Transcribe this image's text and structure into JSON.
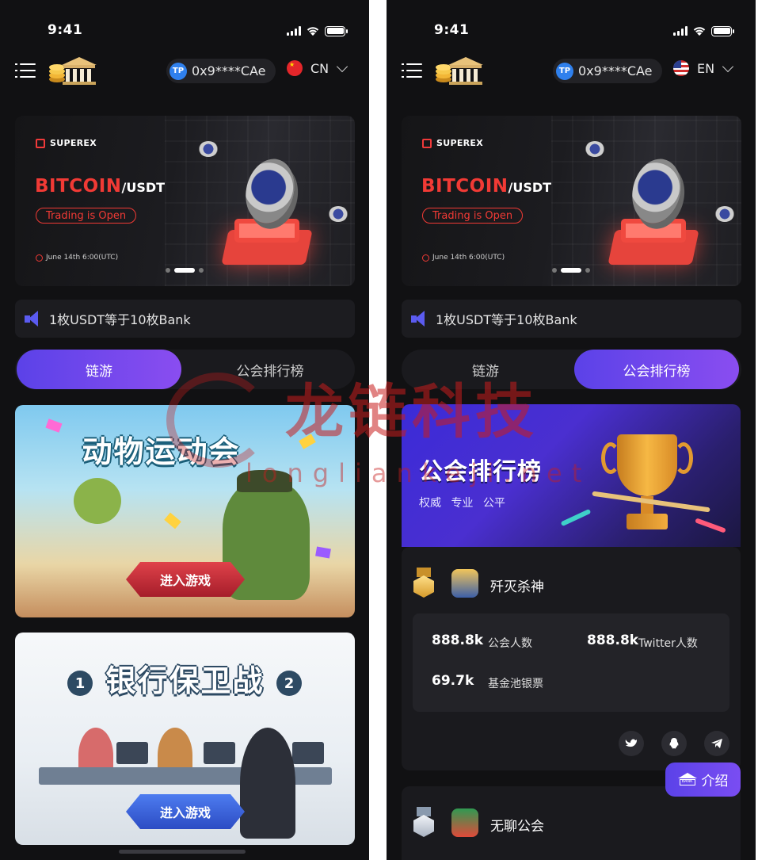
{
  "colors": {
    "background": "#111113",
    "accent_gradient_start": "#5b42e8",
    "accent_gradient_end": "#8a4df0",
    "brand_red": "#f13a35",
    "card": "#1a1a1e"
  },
  "screens": [
    {
      "status": {
        "time": "9:41"
      },
      "header": {
        "address": "0x9****CAe",
        "tp_label": "TP",
        "language": "CN",
        "flag": "china-flag"
      },
      "banner": {
        "brand": "SUPEREX",
        "pair_main": "BITCOIN",
        "pair_quote": "/USDT",
        "badge": "Trading is Open",
        "date": "June 14th  6:00(UTC)"
      },
      "notice": {
        "text": "1枚USDT等于10枚Bank"
      },
      "tabs": [
        {
          "label": "链游",
          "active": true
        },
        {
          "label": "公会排行榜",
          "active": false
        }
      ],
      "games": [
        {
          "title": "动物运动会",
          "button": "进入游戏"
        },
        {
          "title": "银行保卫战",
          "button": "进入游戏",
          "badges": [
            "1",
            "2"
          ]
        }
      ]
    },
    {
      "status": {
        "time": "9:41"
      },
      "header": {
        "address": "0x9****CAe",
        "tp_label": "TP",
        "language": "EN",
        "flag": "us-flag"
      },
      "banner": {
        "brand": "SUPEREX",
        "pair_main": "BITCOIN",
        "pair_quote": "/USDT",
        "badge": "Trading is Open",
        "date": "June 14th  6:00(UTC)"
      },
      "notice": {
        "text": "1枚USDT等于10枚Bank"
      },
      "tabs": [
        {
          "label": "链游",
          "active": false
        },
        {
          "label": "公会排行榜",
          "active": true
        }
      ],
      "ranking": {
        "title": "公会排行榜",
        "subtitle": "权威 专业 公平",
        "guilds": [
          {
            "name": "歼灭杀神",
            "medal": "gold",
            "stats": [
              {
                "value": "888.8k",
                "label": "公会人数"
              },
              {
                "value": "888.8k",
                "label": "Twitter人数"
              },
              {
                "value": "69.7k",
                "label": "基金池银票"
              }
            ],
            "socials": [
              "twitter-icon",
              "qq-icon",
              "telegram-icon"
            ]
          },
          {
            "name": "无聊公会",
            "medal": "silver"
          }
        ],
        "intro_button": {
          "label": "介绍",
          "icon_text": "BANK"
        }
      }
    }
  ],
  "watermark": {
    "cn": "龙链科技",
    "en": "longliankeji.net"
  }
}
